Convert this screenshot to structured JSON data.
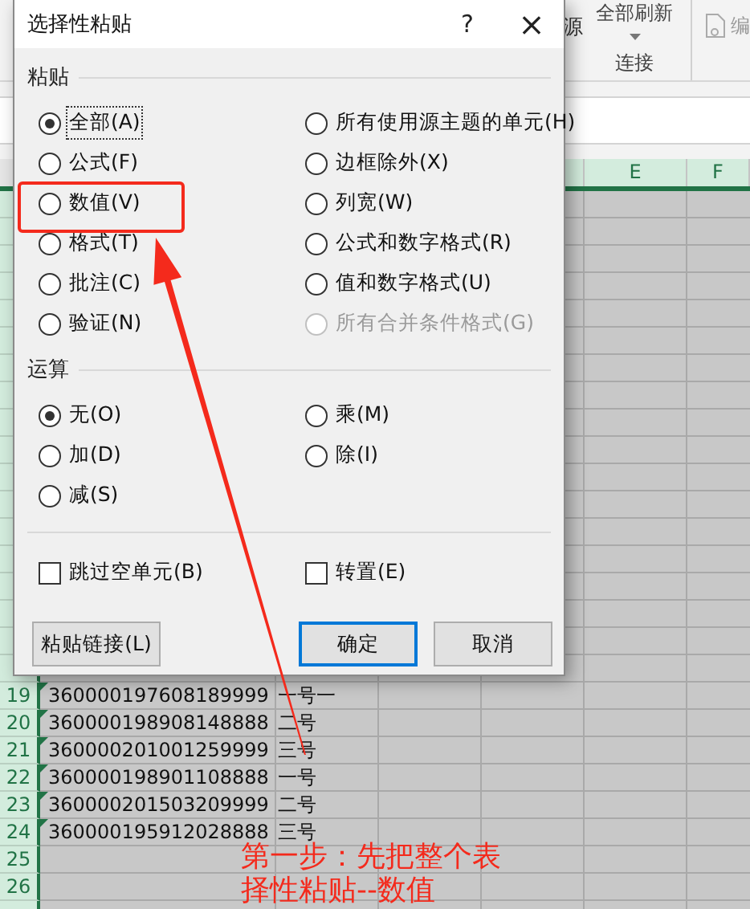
{
  "ribbon": {
    "refresh_all": "全部刷新",
    "source": "源",
    "connections": "连接",
    "edit": "编"
  },
  "sheet": {
    "columns": [
      {
        "label": "E",
        "selected": true
      },
      {
        "label": "F",
        "selected": true
      }
    ],
    "rows": [
      {
        "number": "19",
        "column_a": "360000197608189999",
        "column_b": "一号一"
      },
      {
        "number": "20",
        "column_a": "360000198908148888",
        "column_b": "二号"
      },
      {
        "number": "21",
        "column_a": "360000201001259999",
        "column_b": "三号"
      },
      {
        "number": "22",
        "column_a": "360000198901108888",
        "column_b": "一号"
      },
      {
        "number": "23",
        "column_a": "360000201503209999",
        "column_b": "二号"
      },
      {
        "number": "24",
        "column_a": "360000195912028888",
        "column_b": "三号"
      },
      {
        "number": "25"
      },
      {
        "number": "26"
      }
    ]
  },
  "dialog": {
    "title": "选择性粘贴",
    "help": "?",
    "close": "×",
    "paste_heading": "粘贴",
    "paste_options": [
      {
        "label": "全部(A)",
        "selected": true,
        "focused": true,
        "disabled": false
      },
      {
        "label": "所有使用源主题的单元(H)",
        "selected": false,
        "focused": false,
        "disabled": false
      },
      {
        "label": "公式(F)",
        "selected": false,
        "focused": false,
        "disabled": false
      },
      {
        "label": "边框除外(X)",
        "selected": false,
        "focused": false,
        "disabled": false
      },
      {
        "label": "数值(V)",
        "selected": false,
        "focused": false,
        "disabled": false
      },
      {
        "label": "列宽(W)",
        "selected": false,
        "focused": false,
        "disabled": false
      },
      {
        "label": "格式(T)",
        "selected": false,
        "focused": false,
        "disabled": false
      },
      {
        "label": "公式和数字格式(R)",
        "selected": false,
        "focused": false,
        "disabled": false
      },
      {
        "label": "批注(C)",
        "selected": false,
        "focused": false,
        "disabled": false
      },
      {
        "label": "值和数字格式(U)",
        "selected": false,
        "focused": false,
        "disabled": false
      },
      {
        "label": "验证(N)",
        "selected": false,
        "focused": false,
        "disabled": false
      },
      {
        "label": "所有合并条件格式(G)",
        "selected": false,
        "focused": false,
        "disabled": true
      }
    ],
    "operation_heading": "运算",
    "operation_options": [
      {
        "label": "无(O)",
        "selected": true
      },
      {
        "label": "乘(M)",
        "selected": false
      },
      {
        "label": "加(D)",
        "selected": false
      },
      {
        "label": "除(I)",
        "selected": false
      },
      {
        "label": "减(S)",
        "selected": false
      }
    ],
    "checkboxes": [
      {
        "label": "跳过空单元(B)",
        "checked": false
      },
      {
        "label": "转置(E)",
        "checked": false
      }
    ],
    "buttons": [
      {
        "label": "粘贴链接(L)",
        "default": false
      },
      {
        "label": "确定",
        "default": true
      },
      {
        "label": "取消",
        "default": false
      }
    ]
  },
  "annotation": {
    "lines": [
      "第一步：先把整个表",
      "择性粘贴--数值"
    ]
  }
}
